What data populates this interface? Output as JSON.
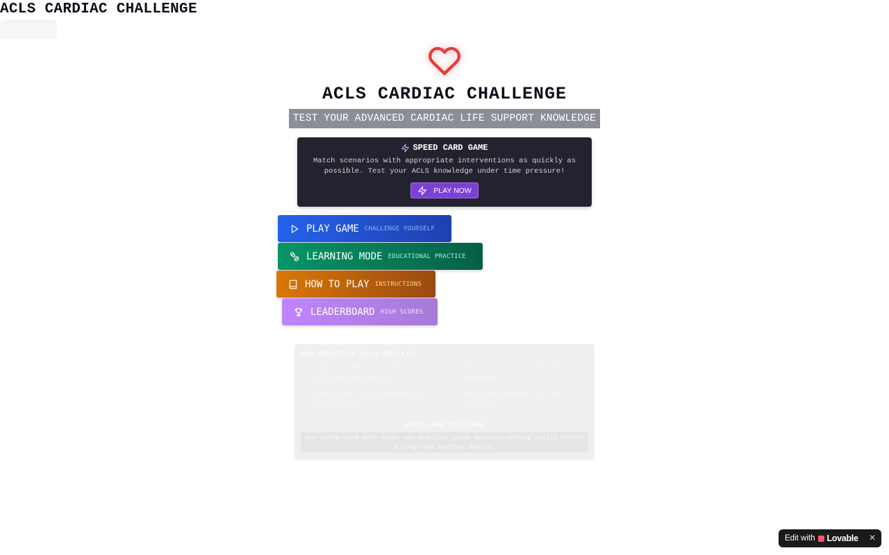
{
  "header": {
    "title": "ACLS CARDIAC CHALLENGE"
  },
  "hero": {
    "icon": "heart-icon",
    "title": "ACLS CARDIAC CHALLENGE",
    "subtitle": "TEST YOUR ADVANCED CARDIAC LIFE SUPPORT KNOWLEDGE"
  },
  "speed_card": {
    "icon": "lightning-icon",
    "title": "SPEED CARD GAME",
    "description": "Match scenarios with appropriate interventions as quickly as possible. Test your ACLS knowledge under time pressure!",
    "button_label": "PLAY NOW"
  },
  "menu": [
    {
      "icon": "play-icon",
      "label": "PLAY GAME",
      "sublabel": "CHALLENGE YOURSELF",
      "color": "#2563eb"
    },
    {
      "icon": "pills-icon",
      "label": "LEARNING MODE",
      "sublabel": "EDUCATIONAL PRACTICE",
      "color": "#059669"
    },
    {
      "icon": "book-icon",
      "label": "HOW TO PLAY",
      "sublabel": "INSTRUCTIONS",
      "color": "#d97706"
    },
    {
      "icon": "trophy-icon",
      "label": "LEADERBOARD",
      "sublabel": "HIGH SCORES",
      "color": "#c084fc"
    }
  ],
  "why": {
    "title": "WHY PRACTICE ACLS SKILLS?",
    "items": [
      "Improve reaction time in cardiac emergencies",
      "Master critical intervention sequences",
      "Recognize life-threatening arrhythmias",
      "Build confidence for real scenarios"
    ],
    "subheading": "SPEED CARD CHALLENGE",
    "box_text": "Our Speed Card Game helps you practice quick decision-making skills needed during real cardiac events."
  },
  "badge": {
    "edit_label": "Edit with",
    "brand": "Lovable",
    "close": "✕"
  }
}
